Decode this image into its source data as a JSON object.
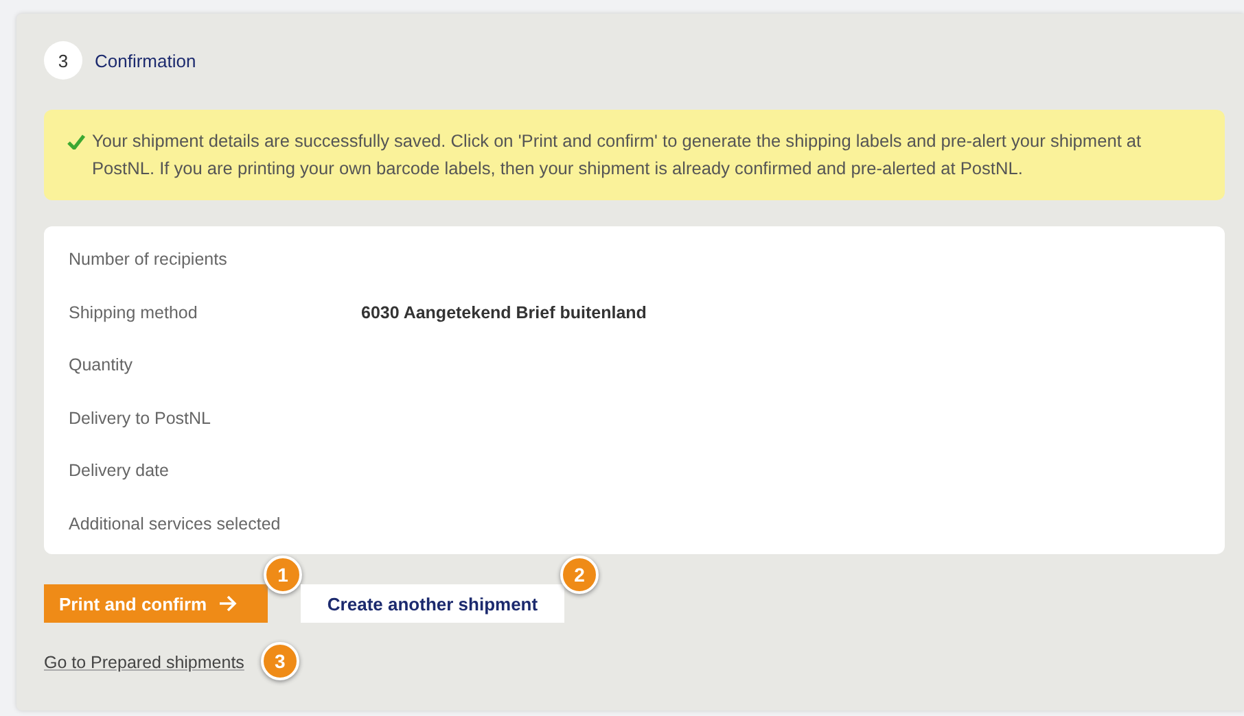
{
  "step": {
    "number": "3",
    "title": "Confirmation"
  },
  "notice": {
    "text": "Your shipment details are successfully saved. Click on 'Print and confirm' to generate the shipping labels and pre-alert your shipment at PostNL. If you are printing your own barcode labels, then your shipment is already confirmed and pre-alerted at PostNL."
  },
  "details": [
    {
      "label": "Number of recipients"
    },
    {
      "label": "Shipping method",
      "value": "6030 Aangetekend Brief buitenland"
    },
    {
      "label": "Quantity"
    },
    {
      "label": "Delivery to PostNL"
    },
    {
      "label": "Delivery date"
    },
    {
      "label": "Additional services selected"
    }
  ],
  "buttons": [
    {
      "label": "Print and confirm",
      "kind": "primary",
      "callout": "1"
    },
    {
      "label": "Create another shipment",
      "kind": "secondary",
      "callout": "2"
    }
  ],
  "link": {
    "label": "Go to Prepared shipments",
    "callout": "3"
  }
}
